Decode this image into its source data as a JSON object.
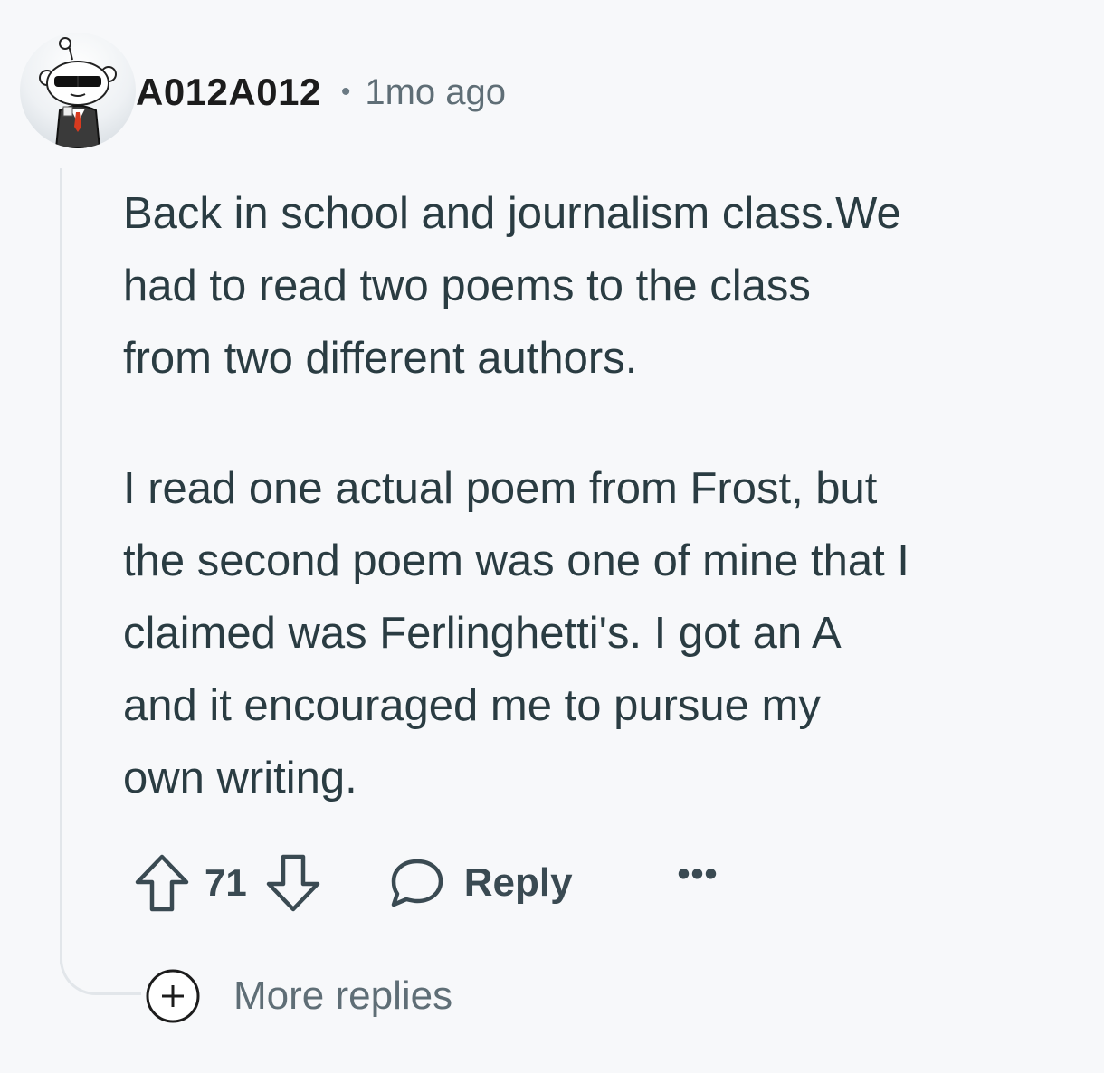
{
  "comment": {
    "author": "A012A012",
    "separator": "•",
    "timestamp": "1mo ago",
    "paragraphs": [
      "Back in school and journalism class.We\nhad to read two poems to the class\nfrom two different authors.",
      "I read one actual poem from Frost, but\nthe second poem was one of mine that I\nclaimed was Ferlinghetti's. I got an A\nand it encouraged me to pursue my\nown writing."
    ],
    "actions": {
      "vote_count": "71",
      "reply_label": "Reply",
      "more_label": "•••"
    },
    "more_replies_label": "More replies"
  },
  "icons": {
    "avatar": "snoo-avatar-sunglasses",
    "upvote": "arrow-up-icon",
    "downvote": "arrow-down-icon",
    "reply": "speech-bubble-icon",
    "more": "ellipsis-icon",
    "expand": "plus-circle-icon"
  },
  "colors": {
    "background": "#f7f8fa",
    "text": "#2a3c42",
    "muted": "#5f6e76",
    "thread_line": "#e2e6ea"
  }
}
